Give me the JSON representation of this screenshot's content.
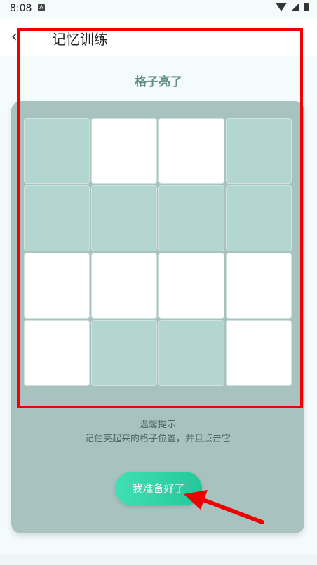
{
  "status": {
    "time": "8:08",
    "notif_icon": "A"
  },
  "app_bar": {
    "back_icon": "chevron-left-icon",
    "back_glyph": "‹",
    "title": "记忆训练"
  },
  "subtitle": "格子亮了",
  "grid": {
    "rows": [
      [
        "dim",
        "lit",
        "lit",
        "dim"
      ],
      [
        "dim",
        "dim",
        "dim",
        "dim"
      ],
      [
        "lit",
        "lit",
        "lit",
        "lit"
      ],
      [
        "lit",
        "dim",
        "dim",
        "lit"
      ]
    ]
  },
  "tip": {
    "title": "温馨提示",
    "text": "记住亮起来的格子位置，并且点击它"
  },
  "ready_button": {
    "label": "我准备好了"
  },
  "colors": {
    "accent": "#2fd3a7",
    "card": "#a8c3bf",
    "lit": "#ffffff",
    "dim": "#b3d6d0",
    "highlight": "#f00000"
  }
}
